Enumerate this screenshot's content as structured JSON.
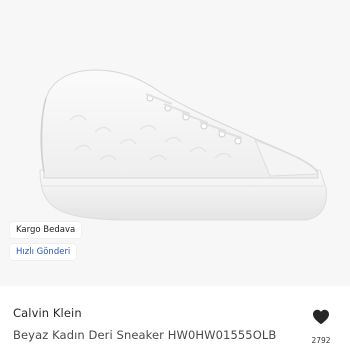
{
  "product": {
    "image_icon": "sneaker-image",
    "badges": {
      "free_shipping": "Kargo Bedava",
      "fast_delivery": "Hızlı Gönderi"
    },
    "brand": "Calvin Klein",
    "title": "Beyaz Kadın Deri Sneaker HW0HW01555OLB",
    "favorite": {
      "icon": "heart-icon",
      "count": "2792"
    }
  },
  "colors": {
    "fast_delivery_text": "#2a55b8",
    "heart": "#262626"
  }
}
